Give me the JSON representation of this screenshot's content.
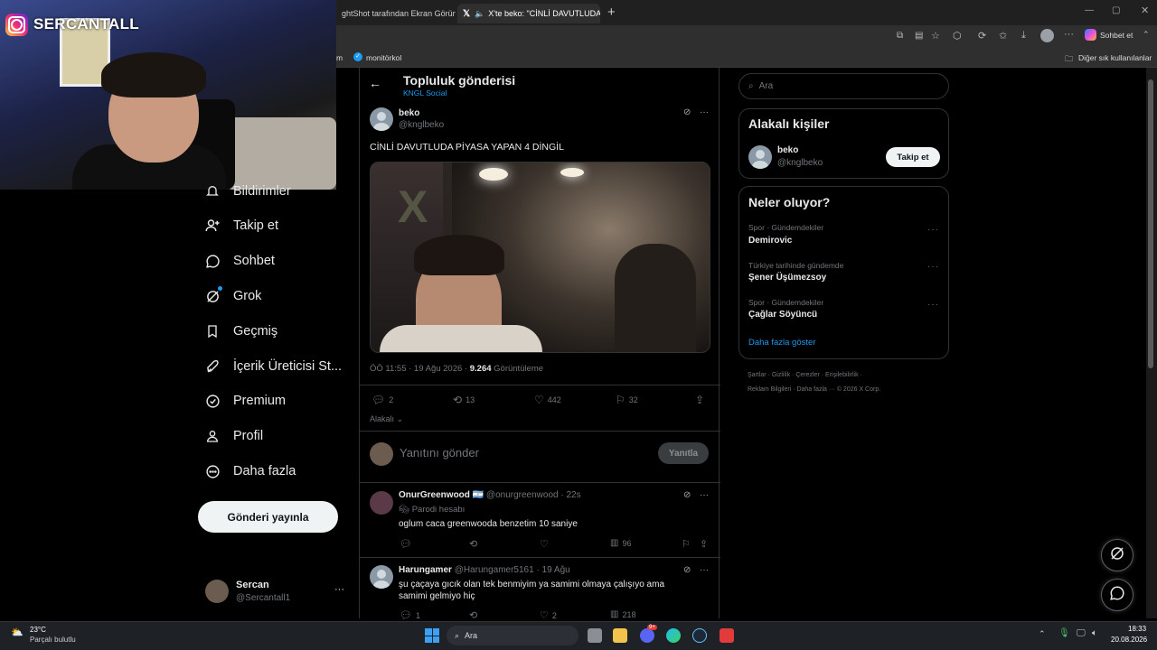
{
  "browser": {
    "tabs": [
      {
        "label": "ghtShot tarafından Ekran Görünt"
      },
      {
        "label": "X'te beko: \"CİNLİ DAVUTLUDA"
      }
    ],
    "copilot_label": "Sohbet et",
    "bookmarks": {
      "item1": "m",
      "item2": "monitörkol",
      "other": "Diğer sık kullanılanlar"
    }
  },
  "webcam": {
    "channel": "SERCANTALL"
  },
  "nav": {
    "items": [
      {
        "label": "Bildirimler"
      },
      {
        "label": "Takip et"
      },
      {
        "label": "Sohbet"
      },
      {
        "label": "Grok"
      },
      {
        "label": "Geçmiş"
      },
      {
        "label": "İçerik Üreticisi St..."
      },
      {
        "label": "Premium"
      },
      {
        "label": "Profil"
      },
      {
        "label": "Daha fazla"
      }
    ],
    "post_button": "Gönderi yayınla",
    "account": {
      "name": "Sercan",
      "handle": "@Sercantall1",
      "more": "···"
    }
  },
  "main": {
    "header": {
      "title": "Topluluk gönderisi",
      "community": "KNGL Social"
    },
    "post": {
      "name": "beko",
      "handle": "@knglbeko",
      "text": "CİNLİ DAVUTLUDA PİYASA YAPAN 4 DİNGİL",
      "time": "ÖÖ 11:55 · 19 Ağu 2026 · ",
      "views": "9.264",
      "views_label": " Görüntüleme",
      "replies": "2",
      "reposts": "13",
      "likes": "442",
      "bookmarks": "32",
      "sort_label": "Alakalı"
    },
    "reply_box": {
      "placeholder": "Yanıtını gönder",
      "button": "Yanıtla"
    },
    "replies": [
      {
        "name": "OnurGreenwood",
        "flag": "🇦🇷",
        "meta": "@onurgreenwood · 22s",
        "badge": "Parodi hesabı",
        "text": "oglum caca greenwooda benzetim 10 saniye",
        "views": "96"
      },
      {
        "name": "Harungamer",
        "meta": "@Harungamer5161 · 19 Ağu",
        "text": "şu çaçaya gıcık olan tek benmiyim ya samimi olmaya çalışıyo ama samimi gelmiyo hiç",
        "replies": "1",
        "likes": "2",
        "views": "218"
      }
    ]
  },
  "sidebar": {
    "search_placeholder": "Ara",
    "people": {
      "title": "Alakalı kişiler",
      "name": "beko",
      "handle": "@knglbeko",
      "follow": "Takip et"
    },
    "trends": {
      "title": "Neler oluyor?",
      "items": [
        {
          "category": "Spor · Gündemdekiler",
          "name": "Demirovic"
        },
        {
          "category": "Türkiye tarihinde gündemde",
          "name": "Şener Üşümezsoy"
        },
        {
          "category": "Spor · Gündemdekiler",
          "name": "Çağlar Söyüncü"
        }
      ],
      "more": "Daha fazla göster"
    },
    "footer": {
      "line1": [
        "Şartlar",
        "Gizlilik",
        "Çerezler",
        "Erişilebilirlik"
      ],
      "line2": [
        "Reklam Bilgileri",
        "Daha fazla ···",
        "© 2026 X Corp."
      ]
    }
  },
  "taskbar": {
    "weather_temp": "23°C",
    "weather_desc": "Parçalı bulutlu",
    "search": "Ara",
    "time": "18:33",
    "date": "20.08.2026",
    "discord_badge": "9+"
  }
}
